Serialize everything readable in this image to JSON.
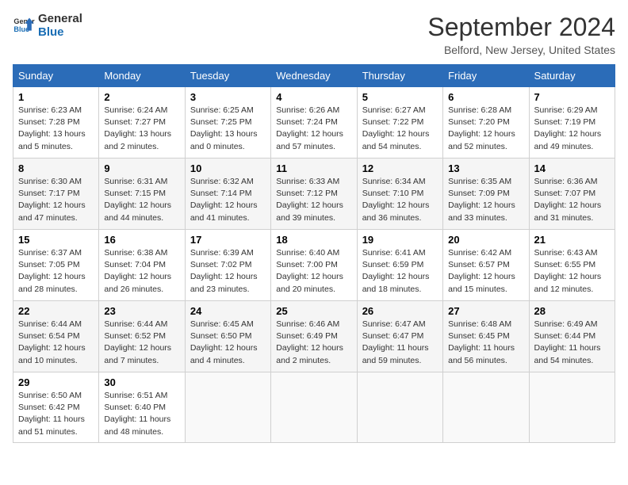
{
  "header": {
    "logo_line1": "General",
    "logo_line2": "Blue",
    "month": "September 2024",
    "location": "Belford, New Jersey, United States"
  },
  "days_of_week": [
    "Sunday",
    "Monday",
    "Tuesday",
    "Wednesday",
    "Thursday",
    "Friday",
    "Saturday"
  ],
  "weeks": [
    [
      {
        "day": "1",
        "sunrise": "6:23 AM",
        "sunset": "7:28 PM",
        "daylight": "13 hours and 5 minutes."
      },
      {
        "day": "2",
        "sunrise": "6:24 AM",
        "sunset": "7:27 PM",
        "daylight": "13 hours and 2 minutes."
      },
      {
        "day": "3",
        "sunrise": "6:25 AM",
        "sunset": "7:25 PM",
        "daylight": "13 hours and 0 minutes."
      },
      {
        "day": "4",
        "sunrise": "6:26 AM",
        "sunset": "7:24 PM",
        "daylight": "12 hours and 57 minutes."
      },
      {
        "day": "5",
        "sunrise": "6:27 AM",
        "sunset": "7:22 PM",
        "daylight": "12 hours and 54 minutes."
      },
      {
        "day": "6",
        "sunrise": "6:28 AM",
        "sunset": "7:20 PM",
        "daylight": "12 hours and 52 minutes."
      },
      {
        "day": "7",
        "sunrise": "6:29 AM",
        "sunset": "7:19 PM",
        "daylight": "12 hours and 49 minutes."
      }
    ],
    [
      {
        "day": "8",
        "sunrise": "6:30 AM",
        "sunset": "7:17 PM",
        "daylight": "12 hours and 47 minutes."
      },
      {
        "day": "9",
        "sunrise": "6:31 AM",
        "sunset": "7:15 PM",
        "daylight": "12 hours and 44 minutes."
      },
      {
        "day": "10",
        "sunrise": "6:32 AM",
        "sunset": "7:14 PM",
        "daylight": "12 hours and 41 minutes."
      },
      {
        "day": "11",
        "sunrise": "6:33 AM",
        "sunset": "7:12 PM",
        "daylight": "12 hours and 39 minutes."
      },
      {
        "day": "12",
        "sunrise": "6:34 AM",
        "sunset": "7:10 PM",
        "daylight": "12 hours and 36 minutes."
      },
      {
        "day": "13",
        "sunrise": "6:35 AM",
        "sunset": "7:09 PM",
        "daylight": "12 hours and 33 minutes."
      },
      {
        "day": "14",
        "sunrise": "6:36 AM",
        "sunset": "7:07 PM",
        "daylight": "12 hours and 31 minutes."
      }
    ],
    [
      {
        "day": "15",
        "sunrise": "6:37 AM",
        "sunset": "7:05 PM",
        "daylight": "12 hours and 28 minutes."
      },
      {
        "day": "16",
        "sunrise": "6:38 AM",
        "sunset": "7:04 PM",
        "daylight": "12 hours and 26 minutes."
      },
      {
        "day": "17",
        "sunrise": "6:39 AM",
        "sunset": "7:02 PM",
        "daylight": "12 hours and 23 minutes."
      },
      {
        "day": "18",
        "sunrise": "6:40 AM",
        "sunset": "7:00 PM",
        "daylight": "12 hours and 20 minutes."
      },
      {
        "day": "19",
        "sunrise": "6:41 AM",
        "sunset": "6:59 PM",
        "daylight": "12 hours and 18 minutes."
      },
      {
        "day": "20",
        "sunrise": "6:42 AM",
        "sunset": "6:57 PM",
        "daylight": "12 hours and 15 minutes."
      },
      {
        "day": "21",
        "sunrise": "6:43 AM",
        "sunset": "6:55 PM",
        "daylight": "12 hours and 12 minutes."
      }
    ],
    [
      {
        "day": "22",
        "sunrise": "6:44 AM",
        "sunset": "6:54 PM",
        "daylight": "12 hours and 10 minutes."
      },
      {
        "day": "23",
        "sunrise": "6:44 AM",
        "sunset": "6:52 PM",
        "daylight": "12 hours and 7 minutes."
      },
      {
        "day": "24",
        "sunrise": "6:45 AM",
        "sunset": "6:50 PM",
        "daylight": "12 hours and 4 minutes."
      },
      {
        "day": "25",
        "sunrise": "6:46 AM",
        "sunset": "6:49 PM",
        "daylight": "12 hours and 2 minutes."
      },
      {
        "day": "26",
        "sunrise": "6:47 AM",
        "sunset": "6:47 PM",
        "daylight": "11 hours and 59 minutes."
      },
      {
        "day": "27",
        "sunrise": "6:48 AM",
        "sunset": "6:45 PM",
        "daylight": "11 hours and 56 minutes."
      },
      {
        "day": "28",
        "sunrise": "6:49 AM",
        "sunset": "6:44 PM",
        "daylight": "11 hours and 54 minutes."
      }
    ],
    [
      {
        "day": "29",
        "sunrise": "6:50 AM",
        "sunset": "6:42 PM",
        "daylight": "11 hours and 51 minutes."
      },
      {
        "day": "30",
        "sunrise": "6:51 AM",
        "sunset": "6:40 PM",
        "daylight": "11 hours and 48 minutes."
      },
      null,
      null,
      null,
      null,
      null
    ]
  ]
}
